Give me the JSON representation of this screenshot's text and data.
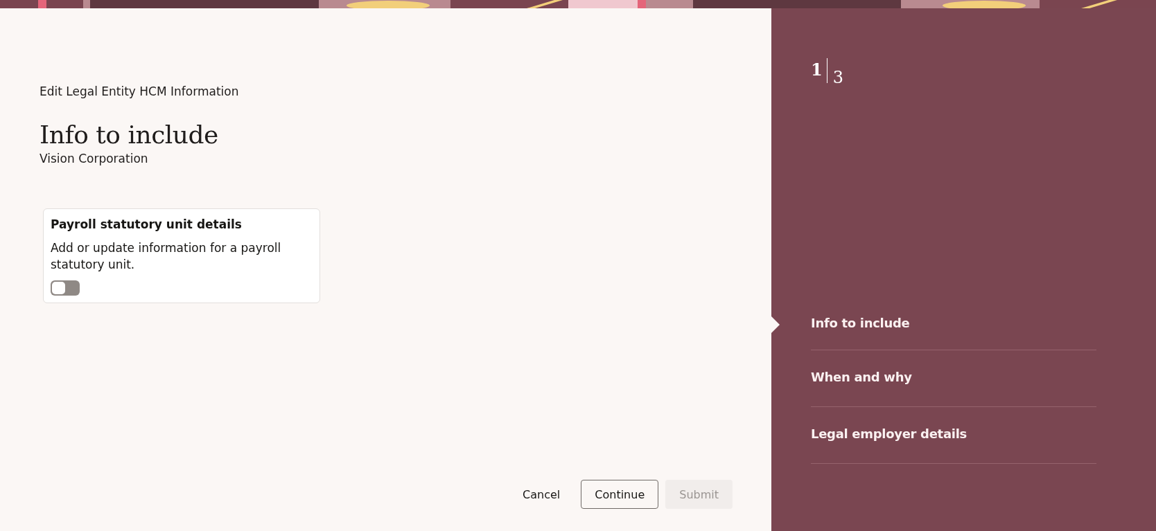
{
  "header": {
    "task": "Edit Legal Entity HCM Information",
    "title": "Info to include",
    "subtitle": "Vision Corporation"
  },
  "cards": [
    {
      "title": "Payroll statutory unit details",
      "description": "Add or update information for a payroll statutory unit.",
      "on": false
    }
  ],
  "buttons": [
    {
      "label": "Cancel",
      "kind": "text",
      "disabled": false
    },
    {
      "label": "Continue",
      "kind": "outlined",
      "disabled": false
    },
    {
      "label": "Submit",
      "kind": "solid",
      "disabled": true
    }
  ],
  "progress": {
    "current": "1",
    "total": "3"
  },
  "steps": [
    {
      "label": "Info to include",
      "selected": true
    },
    {
      "label": "When and why",
      "selected": false
    },
    {
      "label": "Legal employer details",
      "selected": false
    }
  ]
}
